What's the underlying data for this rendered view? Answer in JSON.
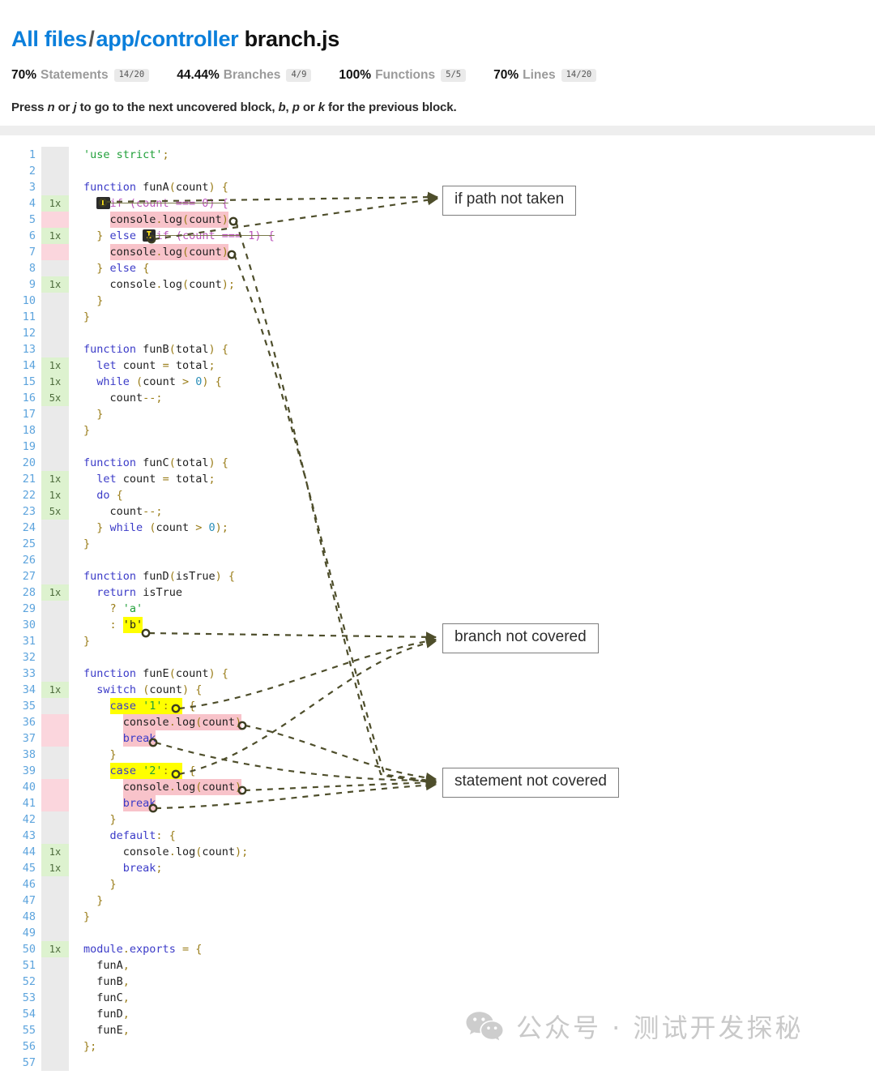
{
  "header": {
    "breadcrumb": {
      "root_label": "All files",
      "separator": "/",
      "dir_label": "app/controller",
      "file_label": "branch.js"
    },
    "stats": [
      {
        "pct": "70%",
        "kind": "Statements",
        "fraction": "14/20"
      },
      {
        "pct": "44.44%",
        "kind": "Branches",
        "fraction": "4/9"
      },
      {
        "pct": "100%",
        "kind": "Functions",
        "fraction": "5/5"
      },
      {
        "pct": "70%",
        "kind": "Lines",
        "fraction": "14/20"
      }
    ],
    "hint_parts": {
      "p1": "Press ",
      "k1": "n",
      "p2": " or ",
      "k2": "j",
      "p3": " to go to the next uncovered block, ",
      "k3": "b",
      "p4": ", ",
      "k4": "p",
      "p5": " or ",
      "k5": "k",
      "p6": " for the previous block."
    }
  },
  "colors": {
    "link": "#0b7fdb",
    "covered_gutter": "#ddf2cf",
    "uncovered_gutter": "#fbd6dd",
    "neutral_gutter": "#eaeaea",
    "statement_miss": "#f8c3ca",
    "branch_miss": "#ffff00",
    "arrow": "#555533",
    "line_number": "#5da4dd"
  },
  "code": {
    "line_numbers": [
      "1",
      "2",
      "3",
      "4",
      "5",
      "6",
      "7",
      "8",
      "9",
      "10",
      "11",
      "12",
      "13",
      "14",
      "15",
      "16",
      "17",
      "18",
      "19",
      "20",
      "21",
      "22",
      "23",
      "24",
      "25",
      "26",
      "27",
      "28",
      "29",
      "30",
      "31",
      "32",
      "33",
      "34",
      "35",
      "36",
      "37",
      "38",
      "39",
      "40",
      "41",
      "42",
      "43",
      "44",
      "45",
      "46",
      "47",
      "48",
      "49",
      "50",
      "51",
      "52",
      "53",
      "54",
      "55",
      "56",
      "57"
    ],
    "hit_counts": [
      {
        "n": 1,
        "text": "",
        "state": "none"
      },
      {
        "n": 2,
        "text": "",
        "state": "blank"
      },
      {
        "n": 3,
        "text": "",
        "state": "none"
      },
      {
        "n": 4,
        "text": "1x",
        "state": "hit"
      },
      {
        "n": 5,
        "text": "",
        "state": "miss"
      },
      {
        "n": 6,
        "text": "1x",
        "state": "hit"
      },
      {
        "n": 7,
        "text": "",
        "state": "miss"
      },
      {
        "n": 8,
        "text": "",
        "state": "none"
      },
      {
        "n": 9,
        "text": "1x",
        "state": "hit"
      },
      {
        "n": 10,
        "text": "",
        "state": "none"
      },
      {
        "n": 11,
        "text": "",
        "state": "none"
      },
      {
        "n": 12,
        "text": "",
        "state": "none"
      },
      {
        "n": 13,
        "text": "",
        "state": "none"
      },
      {
        "n": 14,
        "text": "1x",
        "state": "hit"
      },
      {
        "n": 15,
        "text": "1x",
        "state": "hit"
      },
      {
        "n": 16,
        "text": "5x",
        "state": "hit"
      },
      {
        "n": 17,
        "text": "",
        "state": "none"
      },
      {
        "n": 18,
        "text": "",
        "state": "none"
      },
      {
        "n": 19,
        "text": "",
        "state": "none"
      },
      {
        "n": 20,
        "text": "",
        "state": "none"
      },
      {
        "n": 21,
        "text": "1x",
        "state": "hit"
      },
      {
        "n": 22,
        "text": "1x",
        "state": "hit"
      },
      {
        "n": 23,
        "text": "5x",
        "state": "hit"
      },
      {
        "n": 24,
        "text": "",
        "state": "none"
      },
      {
        "n": 25,
        "text": "",
        "state": "none"
      },
      {
        "n": 26,
        "text": "",
        "state": "none"
      },
      {
        "n": 27,
        "text": "",
        "state": "none"
      },
      {
        "n": 28,
        "text": "1x",
        "state": "hit"
      },
      {
        "n": 29,
        "text": "",
        "state": "none"
      },
      {
        "n": 30,
        "text": "",
        "state": "none"
      },
      {
        "n": 31,
        "text": "",
        "state": "none"
      },
      {
        "n": 32,
        "text": "",
        "state": "none"
      },
      {
        "n": 33,
        "text": "",
        "state": "none"
      },
      {
        "n": 34,
        "text": "1x",
        "state": "hit"
      },
      {
        "n": 35,
        "text": "",
        "state": "none"
      },
      {
        "n": 36,
        "text": "",
        "state": "miss"
      },
      {
        "n": 37,
        "text": "",
        "state": "miss"
      },
      {
        "n": 38,
        "text": "",
        "state": "none"
      },
      {
        "n": 39,
        "text": "",
        "state": "none"
      },
      {
        "n": 40,
        "text": "",
        "state": "miss"
      },
      {
        "n": 41,
        "text": "",
        "state": "miss"
      },
      {
        "n": 42,
        "text": "",
        "state": "none"
      },
      {
        "n": 43,
        "text": "",
        "state": "none"
      },
      {
        "n": 44,
        "text": "1x",
        "state": "hit"
      },
      {
        "n": 45,
        "text": "1x",
        "state": "hit"
      },
      {
        "n": 46,
        "text": "",
        "state": "none"
      },
      {
        "n": 47,
        "text": "",
        "state": "none"
      },
      {
        "n": 48,
        "text": "",
        "state": "none"
      },
      {
        "n": 49,
        "text": "",
        "state": "none"
      },
      {
        "n": 50,
        "text": "1x",
        "state": "hit"
      },
      {
        "n": 51,
        "text": "",
        "state": "none"
      },
      {
        "n": 52,
        "text": "",
        "state": "none"
      },
      {
        "n": 53,
        "text": "",
        "state": "none"
      },
      {
        "n": 54,
        "text": "",
        "state": "none"
      },
      {
        "n": 55,
        "text": "",
        "state": "none"
      },
      {
        "n": 56,
        "text": "",
        "state": "none"
      },
      {
        "n": 57,
        "text": "",
        "state": "none"
      }
    ],
    "source_lines": [
      "'use strict';",
      "",
      "function funA(count) {",
      "  if (count === 0) {",
      "    console.log(count)",
      "  } else if (count === 1) {",
      "    console.log(count)",
      "  } else {",
      "    console.log(count);",
      "  }",
      "}",
      "",
      "function funB(total) {",
      "  let count = total;",
      "  while (count > 0) {",
      "    count--;",
      "  }",
      "}",
      "",
      "function funC(total) {",
      "  let count = total;",
      "  do {",
      "    count--;",
      "  } while (count > 0);",
      "}",
      "",
      "function funD(isTrue) {",
      "  return isTrue",
      "    ? 'a'",
      "    : 'b'",
      "}",
      "",
      "function funE(count) {",
      "  switch (count) {",
      "    case '1': {",
      "      console.log(count)",
      "      break",
      "    }",
      "    case '2': {",
      "      console.log(count)",
      "      break",
      "    }",
      "    default: {",
      "      console.log(count);",
      "      break;",
      "    }",
      "  }",
      "}",
      "",
      "module.exports = {",
      "  funA,",
      "  funB,",
      "  funC,",
      "  funD,",
      "  funE,",
      "};",
      ""
    ]
  },
  "annotations": {
    "callouts": [
      {
        "id": "if-path-not-taken",
        "label": "if path not taken"
      },
      {
        "id": "branch-not-covered",
        "label": "branch not covered"
      },
      {
        "id": "statement-not-covered",
        "label": "statement not covered"
      }
    ]
  },
  "watermark": {
    "icon": "wechat-icon",
    "text": "公众号 · 测试开发探秘"
  }
}
